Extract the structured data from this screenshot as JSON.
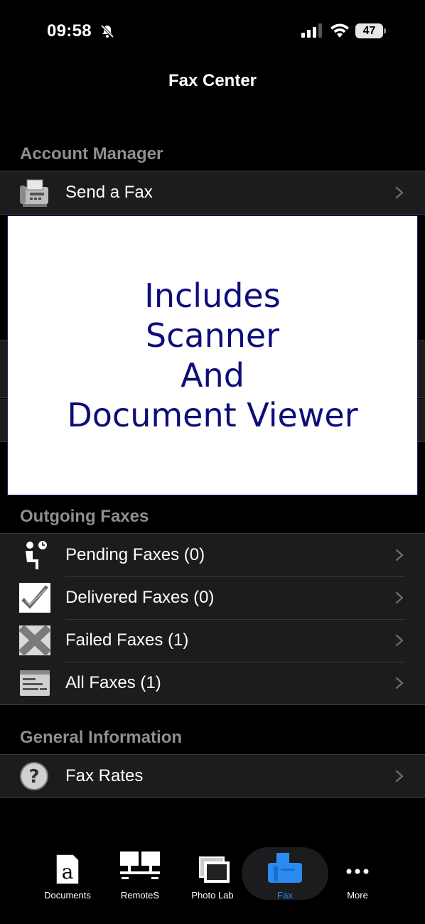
{
  "status_bar": {
    "time": "09:58",
    "battery": "47"
  },
  "nav": {
    "title": "Fax Center"
  },
  "sections": {
    "account": {
      "header": "Account Manager",
      "items": [
        {
          "label": "Send a Fax",
          "icon": "fax-machine-icon"
        }
      ]
    },
    "outgoing": {
      "header": "Outgoing Faxes",
      "items": [
        {
          "label": "Pending Faxes (0)",
          "icon": "pending-icon"
        },
        {
          "label": "Delivered Faxes (0)",
          "icon": "checkmark-icon"
        },
        {
          "label": "Failed Faxes (1)",
          "icon": "failed-x-icon"
        },
        {
          "label": "All Faxes (1)",
          "icon": "list-icon"
        }
      ]
    },
    "general": {
      "header": "General Information",
      "items": [
        {
          "label": "Fax Rates",
          "icon": "question-icon"
        }
      ]
    }
  },
  "promo": {
    "lines": [
      "Includes",
      "Scanner",
      "And",
      "Document Viewer"
    ]
  },
  "tab_bar": {
    "tabs": [
      {
        "label": "Documents",
        "icon": "document-icon"
      },
      {
        "label": "RemoteS",
        "icon": "network-icon"
      },
      {
        "label": "Photo Lab",
        "icon": "photos-icon"
      },
      {
        "label": "Fax",
        "icon": "fax-icon",
        "active": true
      },
      {
        "label": "More",
        "icon": "more-icon"
      }
    ]
  },
  "colors": {
    "accent": "#2a8cf0",
    "promo_text": "#0d0d7a",
    "section_header": "#8e8e93",
    "cell_bg": "#1c1c1e"
  }
}
